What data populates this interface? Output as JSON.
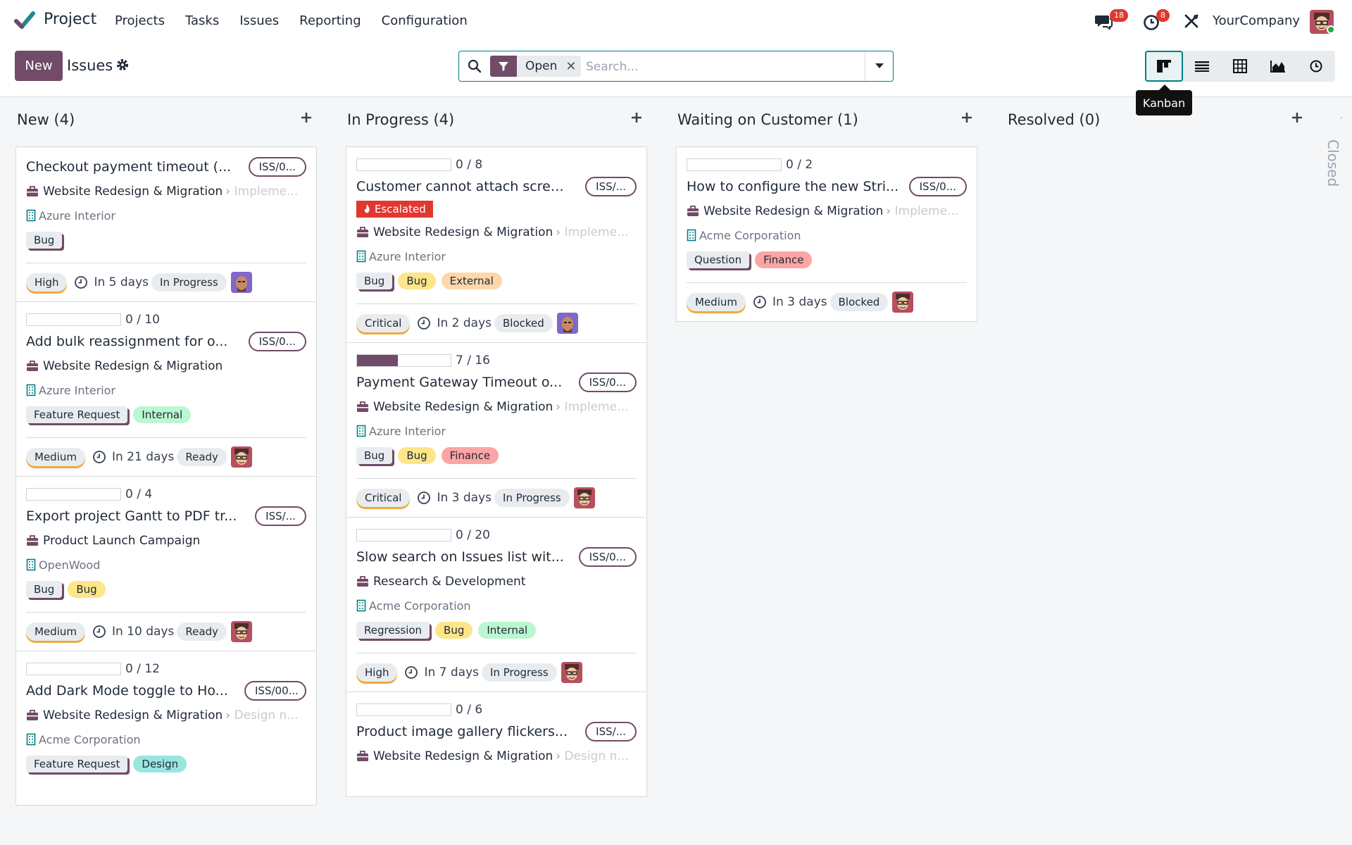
{
  "navbar": {
    "app_name": "Project",
    "menu": [
      "Projects",
      "Tasks",
      "Issues",
      "Reporting",
      "Configuration"
    ],
    "messages_badge": "18",
    "activities_badge": "8",
    "company": "YourCompany"
  },
  "control": {
    "new_label": "New",
    "title": "Issues",
    "facet_label": "Open",
    "search_placeholder": "Search...",
    "views": [
      "kanban-icon",
      "list-icon",
      "pivot-icon",
      "graph-icon",
      "activity-icon"
    ],
    "tooltip": "Kanban"
  },
  "colors": {
    "accent": "#714b67",
    "teal": "#017e84",
    "danger": "#e0382f"
  },
  "columns": [
    {
      "title": "New (4)",
      "cards": [
        {
          "title": "Checkout payment timeout (...",
          "ref": "ISS/0...",
          "project": "Website Redesign & Migration",
          "milestone": "Impleme...",
          "customer": "Azure Interior",
          "tags": [
            [
              "Bug",
              "grey"
            ]
          ],
          "priority": "High",
          "deadline": "In 5 days",
          "state": "In Progress",
          "avatar": "bald"
        },
        {
          "progress": "0 / 10",
          "fill": 0,
          "title": "Add bulk reassignment for o...",
          "ref": "ISS/0...",
          "project": "Website Redesign & Migration",
          "customer": "Azure Interior",
          "tags": [
            [
              "Feature Request",
              "grey"
            ],
            [
              "Internal",
              "green"
            ]
          ],
          "priority": "Medium",
          "deadline": "In 21 days",
          "state": "Ready",
          "avatar": "glasses"
        },
        {
          "progress": "0 / 4",
          "fill": 0,
          "title": "Export project Gantt to PDF tr...",
          "ref": "ISS/...",
          "project": "Product Launch Campaign",
          "customer": "OpenWood",
          "tags": [
            [
              "Bug",
              "grey"
            ],
            [
              "Bug",
              "yellow"
            ]
          ],
          "priority": "Medium",
          "deadline": "In 10 days",
          "state": "Ready",
          "avatar": "glasses"
        },
        {
          "progress": "0 / 12",
          "fill": 0,
          "title": "Add Dark Mode toggle to Ho...",
          "ref": "ISS/00...",
          "project": "Website Redesign & Migration",
          "milestone": "Design n...",
          "customer": "Acme Corporation",
          "tags": [
            [
              "Feature Request",
              "grey"
            ],
            [
              "Design",
              "teal"
            ]
          ]
        }
      ]
    },
    {
      "title": "In Progress (4)",
      "cards": [
        {
          "progress": "0 / 8",
          "fill": 0,
          "title": "Customer cannot attach scree...",
          "ref": "ISS/...",
          "escalated": "Escalated",
          "project": "Website Redesign & Migration",
          "milestone": "Impleme...",
          "customer": "Azure Interior",
          "tags": [
            [
              "Bug",
              "grey"
            ],
            [
              "Bug",
              "yellow"
            ],
            [
              "External",
              "orange"
            ]
          ],
          "priority": "Critical",
          "deadline": "In 2 days",
          "state": "Blocked",
          "avatar": "bald"
        },
        {
          "progress": "7 / 16",
          "fill": 0.4375,
          "title": "Payment Gateway Timeout o...",
          "ref": "ISS/0...",
          "project": "Website Redesign & Migration",
          "milestone": "Impleme...",
          "customer": "Azure Interior",
          "tags": [
            [
              "Bug",
              "grey"
            ],
            [
              "Bug",
              "yellow"
            ],
            [
              "Finance",
              "red"
            ]
          ],
          "priority": "Critical",
          "deadline": "In 3 days",
          "state": "In Progress",
          "avatar": "glasses"
        },
        {
          "progress": "0 / 20",
          "fill": 0,
          "title": "Slow search on Issues list wit...",
          "ref": "ISS/0...",
          "project": "Research & Development",
          "customer": "Acme Corporation",
          "tags": [
            [
              "Regression",
              "grey"
            ],
            [
              "Bug",
              "yellow"
            ],
            [
              "Internal",
              "green"
            ]
          ],
          "priority": "High",
          "deadline": "In 7 days",
          "state": "In Progress",
          "avatar": "glasses"
        },
        {
          "progress": "0 / 6",
          "fill": 0,
          "title": "Product image gallery flickers...",
          "ref": "ISS/...",
          "project": "Website Redesign & Migration",
          "milestone": "Design n..."
        }
      ]
    },
    {
      "title": "Waiting on Customer (1)",
      "cards": [
        {
          "progress": "0 / 2",
          "fill": 0,
          "title": "How to configure the new Stri...",
          "ref": "ISS/0...",
          "project": "Website Redesign & Migration",
          "milestone": "Impleme...",
          "customer": "Acme Corporation",
          "tags": [
            [
              "Question",
              "grey"
            ],
            [
              "Finance",
              "red"
            ]
          ],
          "priority": "Medium",
          "deadline": "In 3 days",
          "state": "Blocked",
          "avatar": "glasses"
        }
      ]
    },
    {
      "title": "Resolved (0)",
      "cards": []
    }
  ],
  "folded_column": "Closed"
}
